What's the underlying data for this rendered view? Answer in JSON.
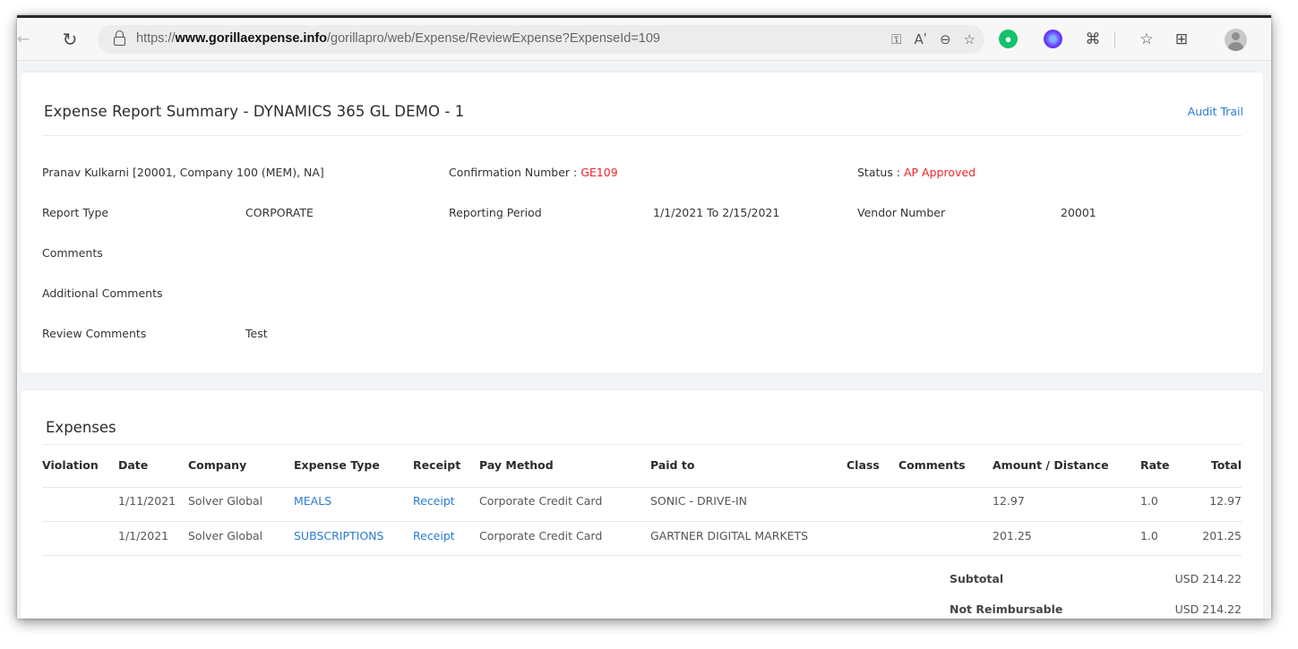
{
  "browser": {
    "url_prefix": "https://",
    "url_domain": "www.gorillaexpense.info",
    "url_path": "/gorillapro/web/Expense/ReviewExpense?ExpenseId=109",
    "read_aloud_label": "Aʹ",
    "icons": [
      "back-icon",
      "refresh-icon",
      "lock-icon",
      "key-icon",
      "read-aloud-icon",
      "zoom-out-icon",
      "favorite-add-icon",
      "grammarly-icon",
      "extension-icon",
      "puzzle-icon",
      "favorites-icon",
      "collections-icon",
      "profile-icon"
    ]
  },
  "summary": {
    "title": "Expense Report Summary - DYNAMICS 365 GL DEMO - 1",
    "audit_trail": "Audit Trail",
    "employee": "Pranav Kulkarni [20001, Company 100 (MEM), NA]",
    "confirmation_label": "Confirmation Number : ",
    "confirmation_value": "GE109",
    "status_label": "Status : ",
    "status_value": "AP Approved",
    "report_type_label": "Report Type",
    "report_type_value": "CORPORATE",
    "reporting_period_label": "Reporting Period",
    "reporting_period_value": "1/1/2021 To 2/15/2021",
    "vendor_number_label": "Vendor Number",
    "vendor_number_value": "20001",
    "comments_label": "Comments",
    "additional_comments_label": "Additional Comments",
    "review_comments_label": "Review Comments",
    "review_comments_value": "Test"
  },
  "expenses": {
    "title": "Expenses",
    "columns": [
      "Violation",
      "Date",
      "Company",
      "Expense Type",
      "Receipt",
      "Pay Method",
      "Paid to",
      "Class",
      "Comments",
      "Amount / Distance",
      "Rate",
      "Total"
    ],
    "rows": [
      {
        "violation": "",
        "date": "1/11/2021",
        "company": "Solver Global",
        "expense_type": "MEALS",
        "receipt": "Receipt",
        "pay_method": "Corporate Credit Card",
        "paid_to": "SONIC - DRIVE-IN",
        "class": "",
        "comments": "",
        "amount": "12.97",
        "rate": "1.0",
        "total": "12.97"
      },
      {
        "violation": "",
        "date": "1/1/2021",
        "company": "Solver Global",
        "expense_type": "SUBSCRIPTIONS",
        "receipt": "Receipt",
        "pay_method": "Corporate Credit Card",
        "paid_to": "GARTNER DIGITAL MARKETS",
        "class": "",
        "comments": "",
        "amount": "201.25",
        "rate": "1.0",
        "total": "201.25"
      }
    ],
    "subtotal_label": "Subtotal",
    "subtotal_value": "USD 214.22",
    "not_reimbursable_label": "Not Reimbursable",
    "not_reimbursable_value": "USD 214.22"
  },
  "colors": {
    "link": "#2a7bd6",
    "alert": "#f0242a",
    "grammarly": "#15c26b"
  }
}
